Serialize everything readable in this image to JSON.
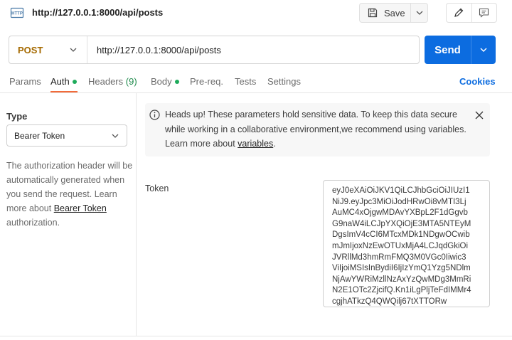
{
  "header": {
    "request_title": "http://127.0.0.1:8000/api/posts",
    "save_label": "Save",
    "icon": "http-icon"
  },
  "request": {
    "method": "POST",
    "url": "http://127.0.0.1:8000/api/posts",
    "send_label": "Send"
  },
  "tabs": [
    {
      "label": "Params"
    },
    {
      "label": "Auth",
      "active": true,
      "dot": true
    },
    {
      "label": "Headers",
      "count": "(9)"
    },
    {
      "label": "Body",
      "dot": true
    },
    {
      "label": "Pre-req."
    },
    {
      "label": "Tests"
    },
    {
      "label": "Settings"
    }
  ],
  "cookies_label": "Cookies",
  "auth": {
    "type_label": "Type",
    "type_value": "Bearer Token",
    "description_prefix": "The authorization header will be automatically generated when you send the request. Learn more about",
    "description_link": "Bearer Token",
    "description_suffix": "authorization."
  },
  "alert": {
    "text_prefix": "Heads up! These parameters hold sensitive data. To keep this data secure while working in a collaborative environment,we recommend using variables. Learn more about",
    "link": "variables",
    "text_suffix": "."
  },
  "token": {
    "label": "Token",
    "lines": [
      "eyJ0eXAiOiJKV1QiLCJhbGciOiJIUzI1",
      "NiJ9.eyJpc3MiOiJodHRwOi8vMTI3Lj",
      "AuMC4xOjgwMDAvYXBpL2F1dGgvb",
      "G9naW4iLCJpYXQiOjE3MTA5NTEyM",
      "DgsImV4cCI6MTcxMDk1NDgwOCwib",
      "mJmIjoxNzEwOTUxMjA4LCJqdGkiOi",
      "JVRllMd3hmRmFMQ3M0VGc0Iiwic3",
      "ViIjoiMSIsInBydiI6IjIzYmQ1Yzg5NDlm",
      "NjAwYWRiMzllNzAxYzQwMDg3MmRi",
      "N2E1OTc2ZjcifQ.Kn1iLgPljTeFdIMMr4",
      "cgjhATkzQ4QWQilj67tXTTORw"
    ]
  },
  "colors": {
    "accent_blue": "#0c6ce0",
    "method_post": "#a56a00",
    "active_tab_underline": "#f26b3a",
    "status_dot": "#1eab5b"
  }
}
